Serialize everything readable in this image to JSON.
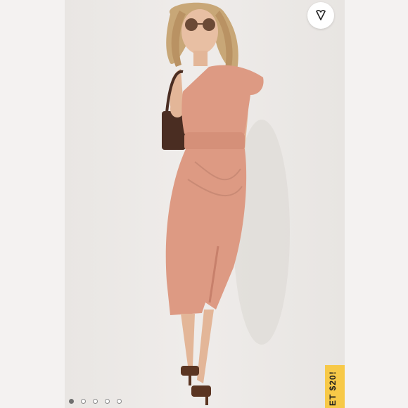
{
  "icons": {
    "like": "heart-icon"
  },
  "carousel": {
    "dot_count": 5,
    "active_index": 0
  },
  "promo": {
    "label": "ET $20!"
  },
  "colors": {
    "dress": "#dd9a83",
    "promo_bg": "#f7c948",
    "background": "#efecea"
  }
}
